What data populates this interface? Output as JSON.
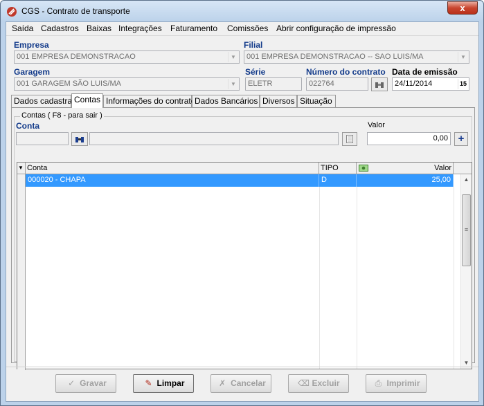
{
  "window": {
    "title": "CGS - Contrato de transporte",
    "close_glyph": "x"
  },
  "menu": [
    {
      "label": "Saída"
    },
    {
      "label": "Cadastros"
    },
    {
      "label": "Baixas"
    },
    {
      "label": "Integrações"
    },
    {
      "label": "Faturamento"
    },
    {
      "label": "Comissões"
    },
    {
      "label": "Abrir configuração de impressão"
    }
  ],
  "form": {
    "empresa_label": "Empresa",
    "empresa_value": "001 EMPRESA DEMONSTRACAO",
    "filial_label": "Filial",
    "filial_value": "001 EMPRESA DEMONSTRACAO -- SAO LUIS/MA",
    "garagem_label": "Garagem",
    "garagem_value": "001 GARAGEM SÃO LUIS/MA",
    "serie_label": "Série",
    "serie_value": "ELETR",
    "numero_label": "Número do contrato",
    "numero_value": "022764",
    "data_label": "Data de emissão",
    "data_value": "24/11/2014"
  },
  "tabs": [
    {
      "label": "Dados cadastrais"
    },
    {
      "label": "Contas"
    },
    {
      "label": "Informações do contrato"
    },
    {
      "label": "Dados Bancários"
    },
    {
      "label": "Diversos"
    },
    {
      "label": "Situação"
    }
  ],
  "contas": {
    "group_title": "Contas ( F8 - para sair )",
    "conta_label": "Conta",
    "valor_label": "Valor",
    "valor_value": "0,00",
    "add_glyph": "+",
    "grid_headers": {
      "conta": "Conta",
      "tipo": "TIPO",
      "valor": "Valor"
    },
    "rows": [
      {
        "conta": "000020 - CHAPA",
        "tipo": "D",
        "valor": "25,00"
      }
    ]
  },
  "buttons": {
    "gravar": "Gravar",
    "limpar": "Limpar",
    "cancelar": "Cancelar",
    "excluir": "Excluir",
    "imprimir": "Imprimir"
  },
  "colors": {
    "accent": "#123a8a",
    "selection": "#3399ff",
    "title_bg": "#bcd2ea"
  }
}
